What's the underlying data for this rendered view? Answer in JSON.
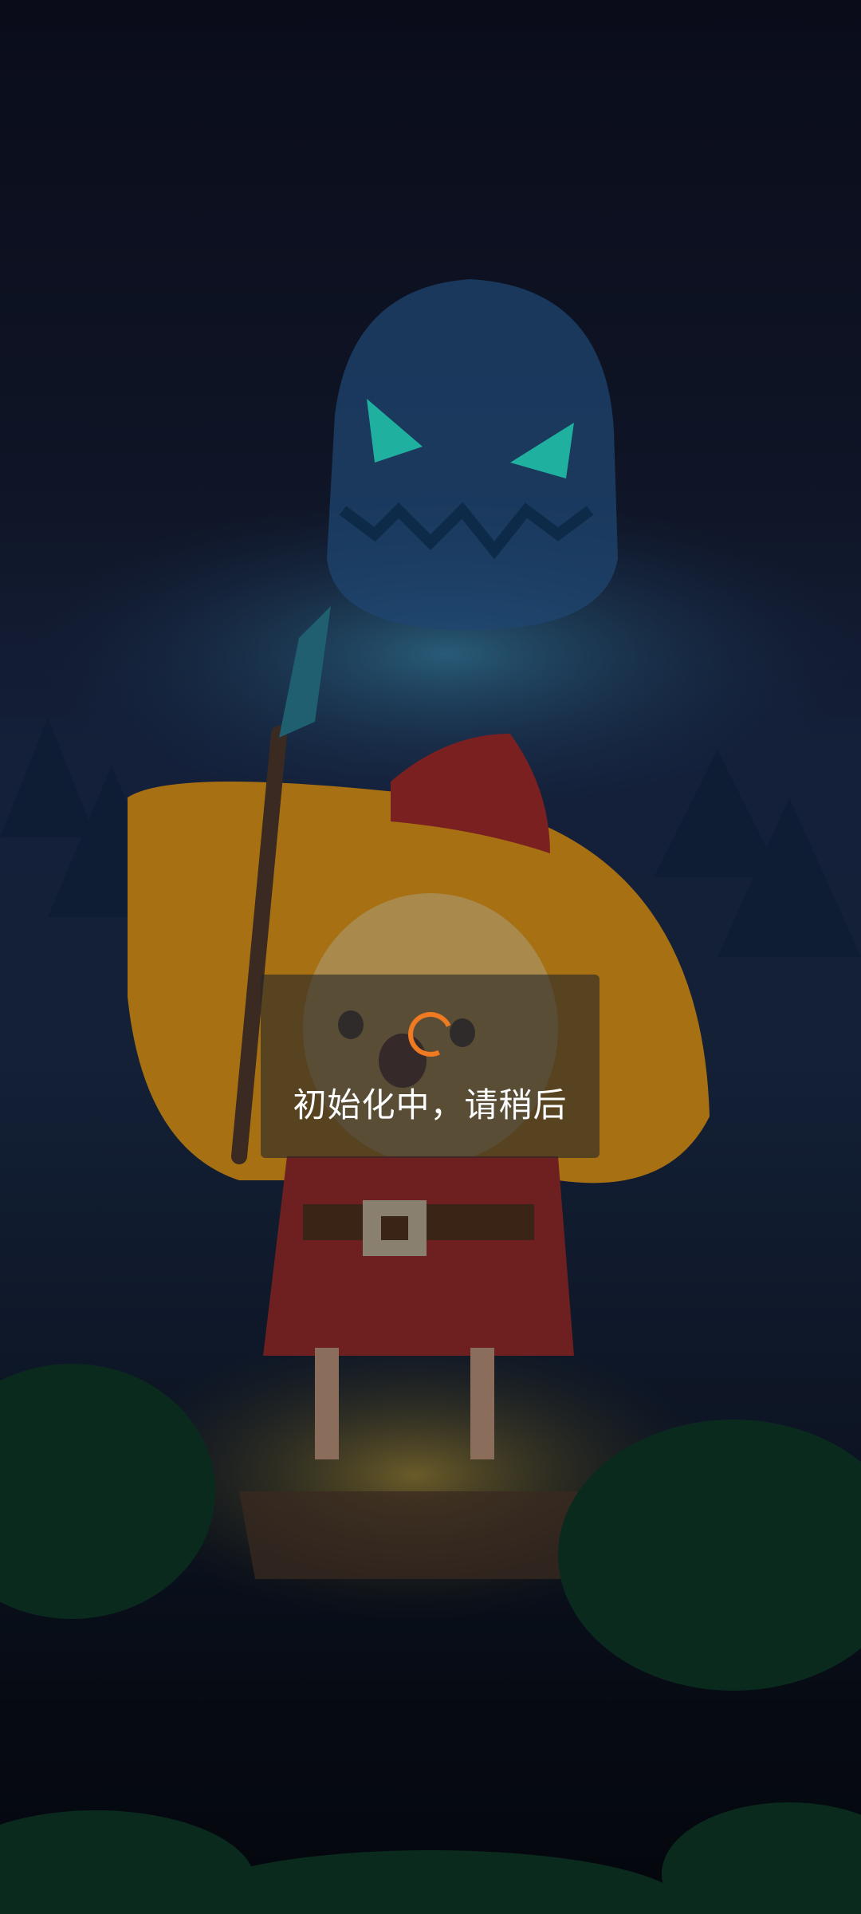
{
  "loading": {
    "message": "初始化中，请稍后",
    "spinner_color": "#f07a22"
  },
  "background": {
    "scene": "forest-night",
    "icons": [
      "ghost-pumpkin-icon",
      "wizard-girl-icon",
      "magic-staff-icon"
    ]
  }
}
